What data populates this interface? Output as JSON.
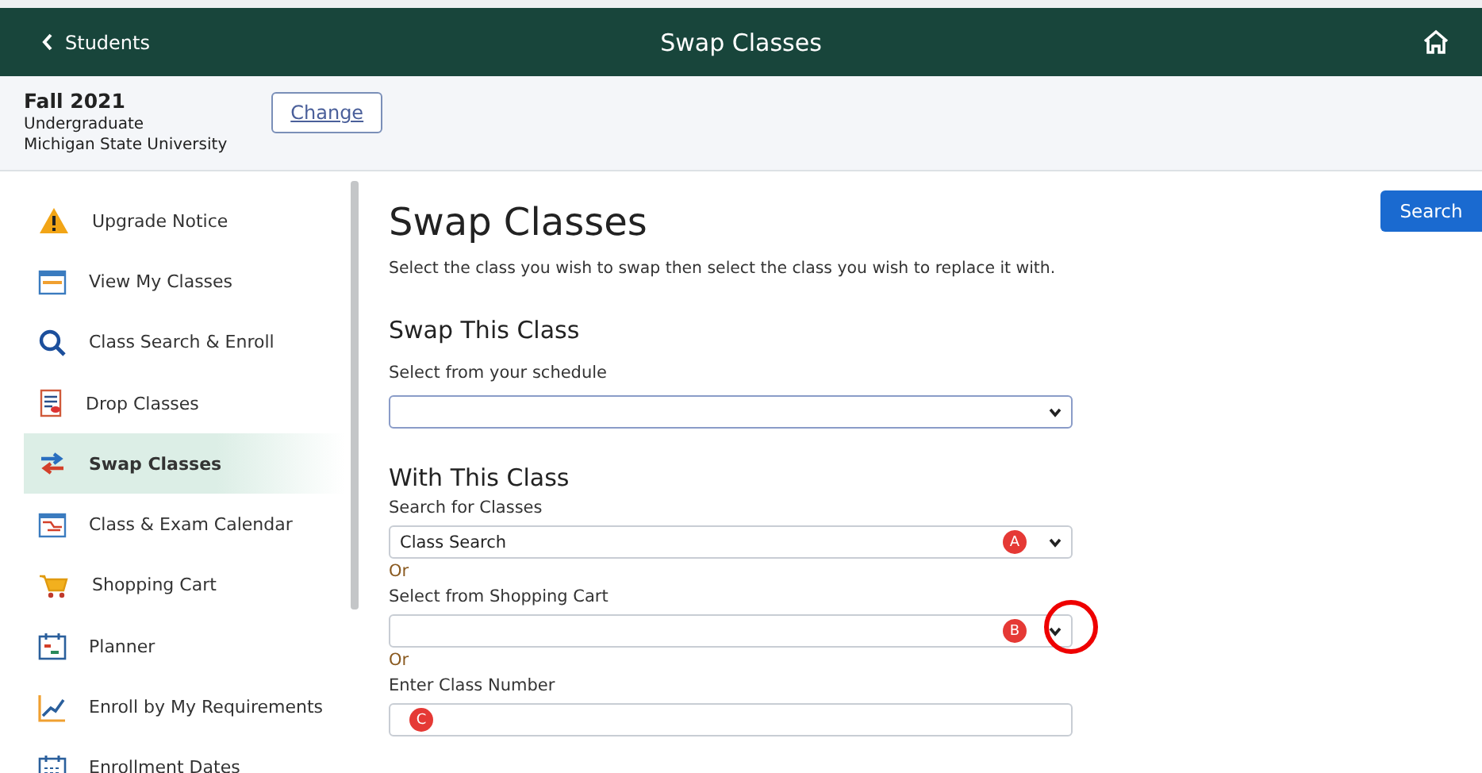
{
  "top_bar": {
    "back_label": "Students",
    "title": "Swap Classes"
  },
  "term": {
    "term": "Fall 2021",
    "career": "Undergraduate",
    "institution": "Michigan State University",
    "change_button": "Change"
  },
  "sidebar": {
    "items": [
      {
        "label": "Upgrade Notice",
        "selected": false
      },
      {
        "label": "View My Classes",
        "selected": false
      },
      {
        "label": "Class Search & Enroll",
        "selected": false
      },
      {
        "label": "Drop Classes",
        "selected": false
      },
      {
        "label": "Swap Classes",
        "selected": true
      },
      {
        "label": "Class & Exam Calendar",
        "selected": false
      },
      {
        "label": "Shopping Cart",
        "selected": false
      },
      {
        "label": "Planner",
        "selected": false
      },
      {
        "label": "Enroll by My Requirements",
        "selected": false
      },
      {
        "label": "Enrollment Dates",
        "selected": false
      }
    ]
  },
  "main": {
    "title": "Swap Classes",
    "search_button": "Search",
    "description": "Select the class you wish to swap then select the class you wish to replace it with.",
    "swap_section": {
      "heading": "Swap This Class",
      "label": "Select from your schedule"
    },
    "with_section": {
      "heading": "With This Class",
      "fields": [
        {
          "kind": "select",
          "label": "Search for Classes",
          "value": "Class Search",
          "marker": "A",
          "circled": false
        },
        {
          "kind": "select",
          "label": "Select from Shopping Cart",
          "marker": "B",
          "circled": true,
          "or_before": "Or"
        },
        {
          "kind": "input",
          "label": "Enter Class Number",
          "marker": "C",
          "circled": false,
          "or_before": "Or"
        }
      ]
    }
  }
}
